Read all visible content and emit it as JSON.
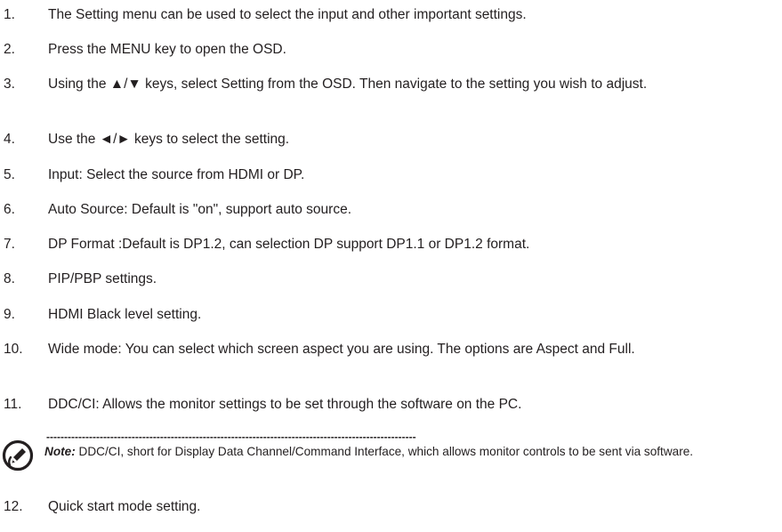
{
  "items": [
    {
      "num": "1.",
      "text": "The Setting menu can be used to select the input and other important settings."
    },
    {
      "num": "2.",
      "text": "Press the MENU key to open the OSD."
    },
    {
      "num": "3.",
      "text": "Using the ▲/▼ keys, select Setting from the OSD. Then navigate to the setting you wish to adjust."
    },
    {
      "num": "4.",
      "text": "Use the ◄/► keys to select the setting."
    },
    {
      "num": "5.",
      "text": "Input: Select the source from HDMI or DP."
    },
    {
      "num": "6.",
      "text": "Auto Source: Default is \"on\", support auto source."
    },
    {
      "num": "7.",
      "text": "DP Format :Default is DP1.2, can selection DP support DP1.1 or DP1.2 format."
    },
    {
      "num": "8.",
      "text": "PIP/PBP settings."
    },
    {
      "num": "9.",
      "text": "HDMI Black level setting."
    },
    {
      "num": "10.",
      "text": "Wide mode: You can select which screen aspect you are using. The options are Aspect and Full."
    },
    {
      "num": "11.",
      "text": "DDC/CI: Allows the monitor settings to be set through the software on the PC."
    },
    {
      "num": "12.",
      "text": "Quick start mode setting."
    }
  ],
  "note": {
    "icon": "note-pen-icon",
    "dashes": "--------------------------------------------------------------------------------------------------------",
    "label": "Note:",
    "text": " DDC/CI, short for Display Data Channel/Command Interface, which allows monitor controls to be sent via software."
  }
}
